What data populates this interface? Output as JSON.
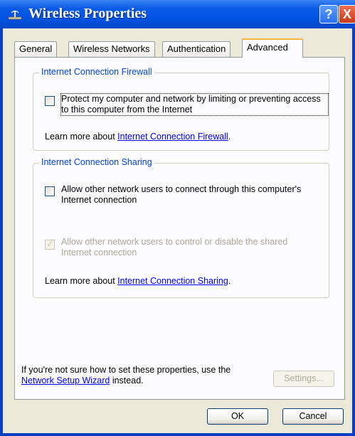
{
  "window": {
    "title": "Wireless Properties",
    "help_glyph": "?",
    "close_glyph": "X"
  },
  "tabs": [
    {
      "label": "General"
    },
    {
      "label": "Wireless Networks"
    },
    {
      "label": "Authentication"
    },
    {
      "label": "Advanced",
      "active": true
    }
  ],
  "firewall": {
    "title": "Internet Connection Firewall",
    "checkbox_label": "Protect my computer and network by limiting or preventing access to this computer from the Internet",
    "checked": false,
    "learn_prefix": "Learn more about ",
    "learn_link": "Internet Connection Firewall",
    "learn_suffix": "."
  },
  "sharing": {
    "title": "Internet Connection Sharing",
    "allow_connect_label": "Allow other network users to connect through this computer's Internet connection",
    "allow_connect_checked": false,
    "allow_control_label": "Allow other network users to control or disable the shared Internet connection",
    "allow_control_checked": true,
    "allow_control_disabled": true,
    "learn_prefix": "Learn more about ",
    "learn_link": "Internet Connection Sharing",
    "learn_suffix": "."
  },
  "footer": {
    "hint_prefix": "If you're not sure how to set these properties, use the ",
    "hint_link": "Network Setup Wizard",
    "hint_suffix": " instead.",
    "settings_label": "Settings..."
  },
  "buttons": {
    "ok_label": "OK",
    "cancel_label": "Cancel"
  },
  "colors": {
    "title_bar": "#0052e0",
    "group_title": "#0046d5",
    "link": "#0000ff",
    "active_tab_highlight": "#f7b33b"
  }
}
